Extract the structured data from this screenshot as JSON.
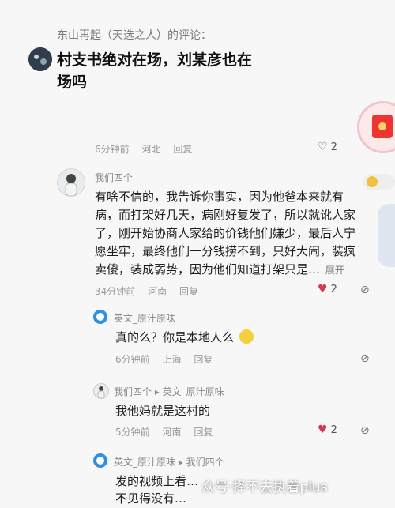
{
  "quote": {
    "header": "东山再起（天选之人）的评论：",
    "line1": "村支书绝对在场，刘某彦也在",
    "line2": "场吗",
    "pinyin_hint": "chǎng ma"
  },
  "c1": {
    "time": "6分钟前",
    "location": "河北",
    "reply": "回复",
    "likes": "2"
  },
  "c2": {
    "user": "我们四个",
    "text": "有啥不信的，我告诉你事实，因为他爸本来就有病，而打架好几天，病刚好复发了，所以就讹人家了，刚开始协商人家给的价钱他们嫌少，最后人宁愿坐牢，最终他们一分钱捞不到，只好大闹，装疯卖傻，装成弱势，因为他们知道打架只是…",
    "expand": "展开",
    "time": "34分钟前",
    "location": "河南",
    "reply": "回复",
    "likes": "2"
  },
  "r1": {
    "user": "英文_原汁原味",
    "text": "真的么？你是本地人么",
    "time": "6分钟前",
    "location": "上海",
    "reply": "回复"
  },
  "r2": {
    "user": "我们四个 ▸ 英文_原汁原味",
    "text": "我他妈就是这村的",
    "time": "5分钟前",
    "location": "河南",
    "reply": "回复",
    "likes": "2"
  },
  "r3": {
    "user": "英文_原汁原味 ▸ 我们四个",
    "text": "发的视频上看…",
    "text2": "不见得没有…"
  },
  "watermark": "众号·择不去执着plus"
}
